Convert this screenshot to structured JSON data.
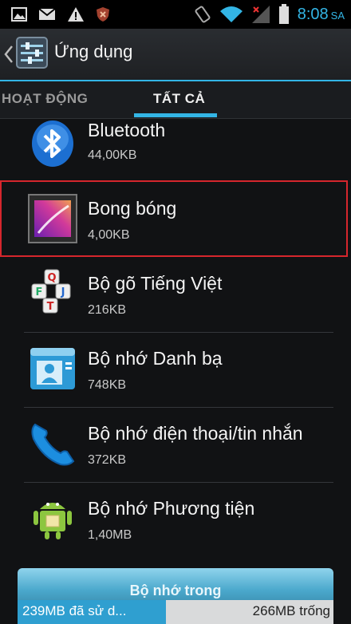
{
  "status_bar": {
    "time": "8:08",
    "ampm": "SA",
    "left_icons": [
      "picture-icon",
      "gmail-icon",
      "warning-icon",
      "shield-icon"
    ],
    "right_icons": [
      "rotate-icon",
      "wifi-icon",
      "signal-icon",
      "battery-icon"
    ]
  },
  "action_bar": {
    "title": "Ứng dụng",
    "icon": "settings-sliders-icon"
  },
  "tabs": [
    {
      "label": "HOẠT ĐỘNG",
      "active": false
    },
    {
      "label": "TẤT CẢ",
      "active": true
    }
  ],
  "apps": [
    {
      "name": "Bluetooth",
      "size": "44,00KB",
      "icon": "bluetooth-icon"
    },
    {
      "name": "Bong bóng",
      "size": "4,00KB",
      "icon": "bubbles-wallpaper-icon",
      "highlighted": true
    },
    {
      "name": "Bộ gõ Tiếng Việt",
      "size": "216KB",
      "icon": "keyboard-keys-icon"
    },
    {
      "name": "Bộ nhớ Danh bạ",
      "size": "748KB",
      "icon": "contacts-storage-icon"
    },
    {
      "name": "Bộ nhớ điện thoại/tin nhắn",
      "size": "372KB",
      "icon": "phone-handset-icon"
    },
    {
      "name": "Bộ nhớ Phương tiện",
      "size": "1,40MB",
      "icon": "android-media-icon"
    }
  ],
  "storage": {
    "title": "Bộ nhớ trong",
    "used_label": "239MB đã sử d...",
    "free_label": "266MB trống",
    "used_fraction": 0.47
  },
  "colors": {
    "accent": "#33b5e5",
    "highlight_border": "#d6262d",
    "background": "#111214"
  }
}
